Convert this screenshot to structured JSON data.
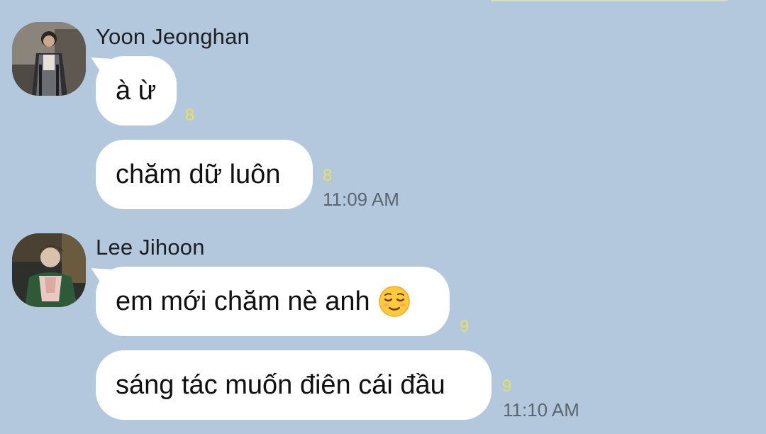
{
  "chat": {
    "messages": [
      {
        "sender": "Yoon Jeonghan",
        "avatar_icon": "profile-photo-icon",
        "bubbles": [
          {
            "text": "à ừ",
            "read_count": "8"
          },
          {
            "text": "chăm dữ luôn",
            "read_count": "8",
            "time": "11:09 AM"
          }
        ]
      },
      {
        "sender": "Lee Jihoon",
        "avatar_icon": "profile-photo-icon",
        "bubbles": [
          {
            "text": "em mới chăm nè anh",
            "emoji": "relieved-face-emoji",
            "read_count": "9"
          },
          {
            "text": "sáng tác muốn điên cái đầu",
            "read_count": "9",
            "time": "11:10 AM"
          }
        ]
      }
    ]
  },
  "colors": {
    "background": "#b3c8dd",
    "bubble": "#ffffff",
    "read_count": "#e9e05a",
    "timestamp": "#5c6670"
  }
}
